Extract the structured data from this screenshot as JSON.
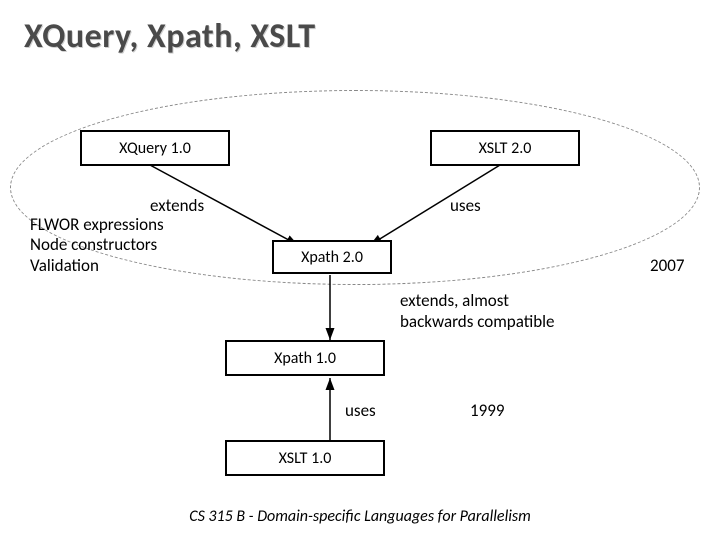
{
  "title": "XQuery, Xpath, XSLT",
  "nodes": {
    "xquery10": "XQuery 1.0",
    "xslt20": "XSLT 2.0",
    "xpath20": "Xpath 2.0",
    "xpath10": "Xpath 1.0",
    "xslt10": "XSLT 1.0"
  },
  "edges": {
    "xquery_extends": "extends",
    "xslt20_uses": "uses",
    "xpath_extends": "extends, almost\nbackwards compatible",
    "xslt10_uses": "uses"
  },
  "notes": {
    "xquery_features": "FLWOR expressions\nNode constructors\nValidation"
  },
  "years": {
    "top_group": "2007",
    "bottom_group": "1999"
  },
  "footer": "CS 315 B - Domain-specific Languages for Parallelism"
}
